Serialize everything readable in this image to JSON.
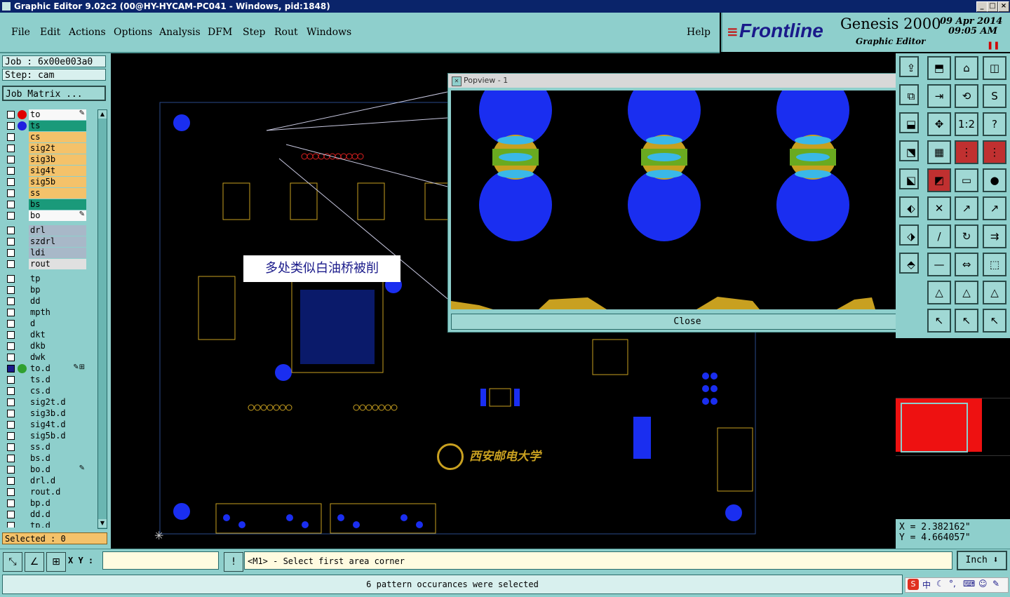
{
  "window": {
    "title": "Graphic Editor 9.02c2 (00@HY-HYCAM-PC041 - Windows, pid:1848)",
    "controls": [
      "_",
      "□",
      "×"
    ]
  },
  "menu": [
    "File",
    "Edit",
    "Actions",
    "Options",
    "Analysis",
    "DFM",
    "Step",
    "Rout",
    "Windows"
  ],
  "help_label": "Help",
  "brand": {
    "logo": "Frontline",
    "product": "Genesis 2000",
    "subtitle": "Graphic Editor",
    "date": "09 Apr 2014",
    "time": "09:05 AM"
  },
  "job": {
    "job_label": "Job : 6x00e003a0",
    "step_label": "Step: cam",
    "matrix_button": "Job Matrix ..."
  },
  "layers": [
    {
      "name": "to",
      "color": "#f8f8f8",
      "dot": "#e00000",
      "flag": "✎",
      "checked": false
    },
    {
      "name": "ts",
      "color": "#1a9a7a",
      "dot": "#2020e0",
      "flag": "",
      "checked": false
    },
    {
      "name": "cs",
      "color": "#f4c26a",
      "flag": "",
      "checked": false
    },
    {
      "name": "sig2t",
      "color": "#f4c26a",
      "flag": "",
      "checked": false
    },
    {
      "name": "sig3b",
      "color": "#f4c26a",
      "flag": "",
      "checked": false
    },
    {
      "name": "sig4t",
      "color": "#f4c26a",
      "flag": "",
      "checked": false
    },
    {
      "name": "sig5b",
      "color": "#f4c26a",
      "flag": "",
      "checked": false
    },
    {
      "name": "ss",
      "color": "#f4c26a",
      "flag": "",
      "checked": false
    },
    {
      "name": "bs",
      "color": "#1a9a7a",
      "flag": "",
      "checked": false
    },
    {
      "name": "bo",
      "color": "#f8f8f8",
      "flag": "✎",
      "checked": false
    },
    {
      "name": "drl",
      "color": "#a8b8c8",
      "flag": "",
      "checked": false,
      "gap": true
    },
    {
      "name": "szdrl",
      "color": "#a8b8c8",
      "flag": "",
      "checked": false
    },
    {
      "name": "ldi",
      "color": "#a8b8c8",
      "flag": "",
      "checked": false
    },
    {
      "name": "rout",
      "color": "#e0e0e0",
      "flag": "",
      "checked": false
    },
    {
      "name": "tp",
      "color": "#8ecfcc",
      "flag": "",
      "checked": false,
      "gap": true
    },
    {
      "name": "bp",
      "color": "#8ecfcc",
      "flag": "",
      "checked": false
    },
    {
      "name": "dd",
      "color": "#8ecfcc",
      "flag": "",
      "checked": false
    },
    {
      "name": "mpth",
      "color": "#8ecfcc",
      "flag": "",
      "checked": false
    },
    {
      "name": "d",
      "color": "#8ecfcc",
      "flag": "",
      "checked": false
    },
    {
      "name": "dkt",
      "color": "#8ecfcc",
      "flag": "",
      "checked": false
    },
    {
      "name": "dkb",
      "color": "#8ecfcc",
      "flag": "",
      "checked": false
    },
    {
      "name": "dwk",
      "color": "#8ecfcc",
      "flag": "",
      "checked": false
    },
    {
      "name": "to.d",
      "color": "#8ecfcc",
      "dot": "#30a030",
      "flag": "✎⊞",
      "checked": true
    },
    {
      "name": "ts.d",
      "color": "#8ecfcc",
      "flag": "",
      "checked": false
    },
    {
      "name": "cs.d",
      "color": "#8ecfcc",
      "flag": "",
      "checked": false
    },
    {
      "name": "sig2t.d",
      "color": "#8ecfcc",
      "flag": "",
      "checked": false
    },
    {
      "name": "sig3b.d",
      "color": "#8ecfcc",
      "flag": "",
      "checked": false
    },
    {
      "name": "sig4t.d",
      "color": "#8ecfcc",
      "flag": "",
      "checked": false
    },
    {
      "name": "sig5b.d",
      "color": "#8ecfcc",
      "flag": "",
      "checked": false
    },
    {
      "name": "ss.d",
      "color": "#8ecfcc",
      "flag": "",
      "checked": false
    },
    {
      "name": "bs.d",
      "color": "#8ecfcc",
      "flag": "",
      "checked": false
    },
    {
      "name": "bo.d",
      "color": "#8ecfcc",
      "flag": "✎",
      "checked": false
    },
    {
      "name": "drl.d",
      "color": "#8ecfcc",
      "flag": "",
      "checked": false
    },
    {
      "name": "rout.d",
      "color": "#8ecfcc",
      "flag": "",
      "checked": false
    },
    {
      "name": "bp.d",
      "color": "#8ecfcc",
      "flag": "",
      "checked": false
    },
    {
      "name": "dd.d",
      "color": "#8ecfcc",
      "flag": "",
      "checked": false
    },
    {
      "name": "tp.d",
      "color": "#8ecfcc",
      "flag": "",
      "checked": false
    }
  ],
  "selected_label": "Selected : 0",
  "annotation": "多处类似白油桥被削",
  "board_logo": "西安邮电大学",
  "popview": {
    "title": "Popview - 1",
    "close_label": "Close"
  },
  "coords": {
    "x": "X =  2.382162\"",
    "y": "Y =  4.664057\""
  },
  "bottom": {
    "xy_label": "X Y :",
    "xy_value": "",
    "prompt": "<M1> - Select first area corner",
    "units": "Inch ⬇"
  },
  "status_message": "6 pattern occurances were selected",
  "colors": {
    "panel": "#8ecfcc",
    "pad": "#1a2ef0",
    "silk": "#f4c26a",
    "copper": "#c8a020"
  }
}
